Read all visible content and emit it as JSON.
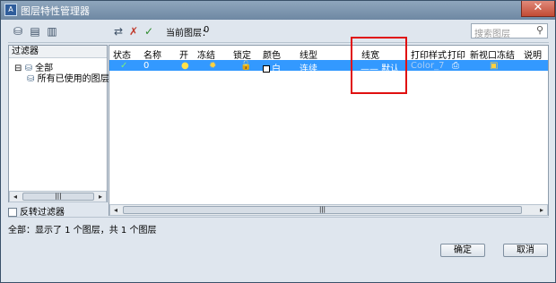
{
  "window": {
    "title": "图层特性管理器",
    "close_glyph": "✕",
    "app_icon": "A"
  },
  "toolbar": {
    "left_icons": [
      "new-property-filter-icon",
      "new-group-filter-icon",
      "layer-states-icon"
    ],
    "right_icons": [
      "new-layer-icon",
      "delete-layer-icon",
      "set-current-icon"
    ],
    "current_layer_label": "当前图层：",
    "current_layer_value": "0",
    "search_placeholder": "搜索图层"
  },
  "filters": {
    "header": "过滤器",
    "tree": [
      {
        "label": "全部",
        "expander": "⊟"
      },
      {
        "label": "所有已使用的图层"
      }
    ],
    "invert_label": "反转过滤器",
    "scroll_thumb": "|||"
  },
  "grid": {
    "columns": [
      "状态",
      "名称",
      "开",
      "冻结",
      "锁定",
      "颜色",
      "线型",
      "线宽",
      "打印样式",
      "打印",
      "新视口冻结",
      "说明"
    ],
    "rows": [
      {
        "status": "✓",
        "name": "0",
        "on": "●",
        "freeze": "✹",
        "lock": "🔓",
        "color": "白",
        "linetype": "连续",
        "lineweight": "—— 默认",
        "plot_style": "Color_7",
        "plot": "⎙",
        "vp_freeze": "▣",
        "description": ""
      }
    ],
    "scroll_thumb": "|||"
  },
  "status_bar": {
    "text": "全部：显示了 1 个图层，共 1 个图层"
  },
  "buttons": {
    "ok": "确定",
    "cancel": "取消"
  }
}
